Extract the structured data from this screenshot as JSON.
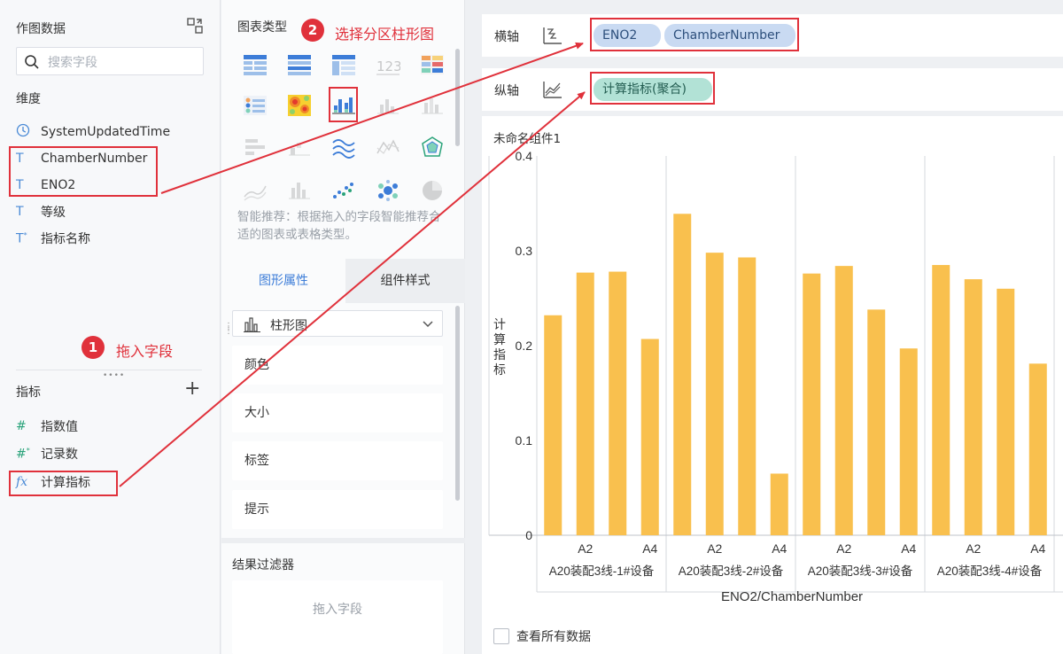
{
  "left": {
    "title": "作图数据",
    "search_placeholder": "搜索字段",
    "dimensions_title": "维度",
    "dimensions": [
      {
        "icon": "clock-icon",
        "label": "SystemUpdatedTime"
      },
      {
        "icon": "text-T-icon",
        "label": "ChamberNumber"
      },
      {
        "icon": "text-T-icon",
        "label": "ENO2"
      },
      {
        "icon": "text-T-icon",
        "label": "等级"
      },
      {
        "icon": "text-T-star-icon",
        "label": "指标名称"
      }
    ],
    "measures_title": "指标",
    "measures": [
      {
        "icon": "hash-icon",
        "label": "指数值"
      },
      {
        "icon": "hash-star-icon",
        "label": "记录数"
      },
      {
        "icon": "fx-icon",
        "label": "计算指标"
      }
    ]
  },
  "middle": {
    "chart_types_title": "图表类型",
    "hint": "智能推荐：根据拖入的字段智能推荐合适的图表或表格类型。",
    "tabs": [
      "图形属性",
      "组件样式"
    ],
    "chart_type_selected": "柱形图",
    "properties": [
      "颜色",
      "大小",
      "标签",
      "提示"
    ],
    "filter_title": "结果过滤器",
    "filter_placeholder": "拖入字段"
  },
  "axes": {
    "x_label": "横轴",
    "x_fields": [
      "ENO2",
      "ChamberNumber"
    ],
    "y_label": "纵轴",
    "y_fields": [
      "计算指标(聚合)"
    ]
  },
  "annotations": {
    "step1_num": "1",
    "step1_text": "拖入字段",
    "step2_num": "2",
    "step2_text": "选择分区柱形图"
  },
  "chart": {
    "component_title": "未命名组件1",
    "view_all": "查看所有数据"
  },
  "colors": {
    "bar": "#f9c04e",
    "accent": "#3d7dd8",
    "annotation": "#e0313b"
  },
  "chart_data": {
    "type": "bar",
    "ylabel": "计算指标",
    "xlabel": "ENO2/ChamberNumber",
    "ylim": [
      0,
      0.4
    ],
    "yticks": [
      "0",
      "0.1",
      "0.2",
      "0.3",
      "0.4"
    ],
    "groups": [
      {
        "name": "A20装配3线-1#设备",
        "ticks": [
          "A2",
          "A4"
        ],
        "values": [
          0.232,
          0.277,
          0.278,
          0.207
        ]
      },
      {
        "name": "A20装配3线-2#设备",
        "ticks": [
          "A2",
          "A4"
        ],
        "values": [
          0.339,
          0.298,
          0.293,
          0.065
        ]
      },
      {
        "name": "A20装配3线-3#设备",
        "ticks": [
          "A2",
          "A4"
        ],
        "values": [
          0.276,
          0.284,
          0.238,
          0.197
        ]
      },
      {
        "name": "A20装配3线-4#设备",
        "ticks": [
          "A2",
          "A4"
        ],
        "values": [
          0.285,
          0.27,
          0.26,
          0.181
        ]
      }
    ]
  }
}
